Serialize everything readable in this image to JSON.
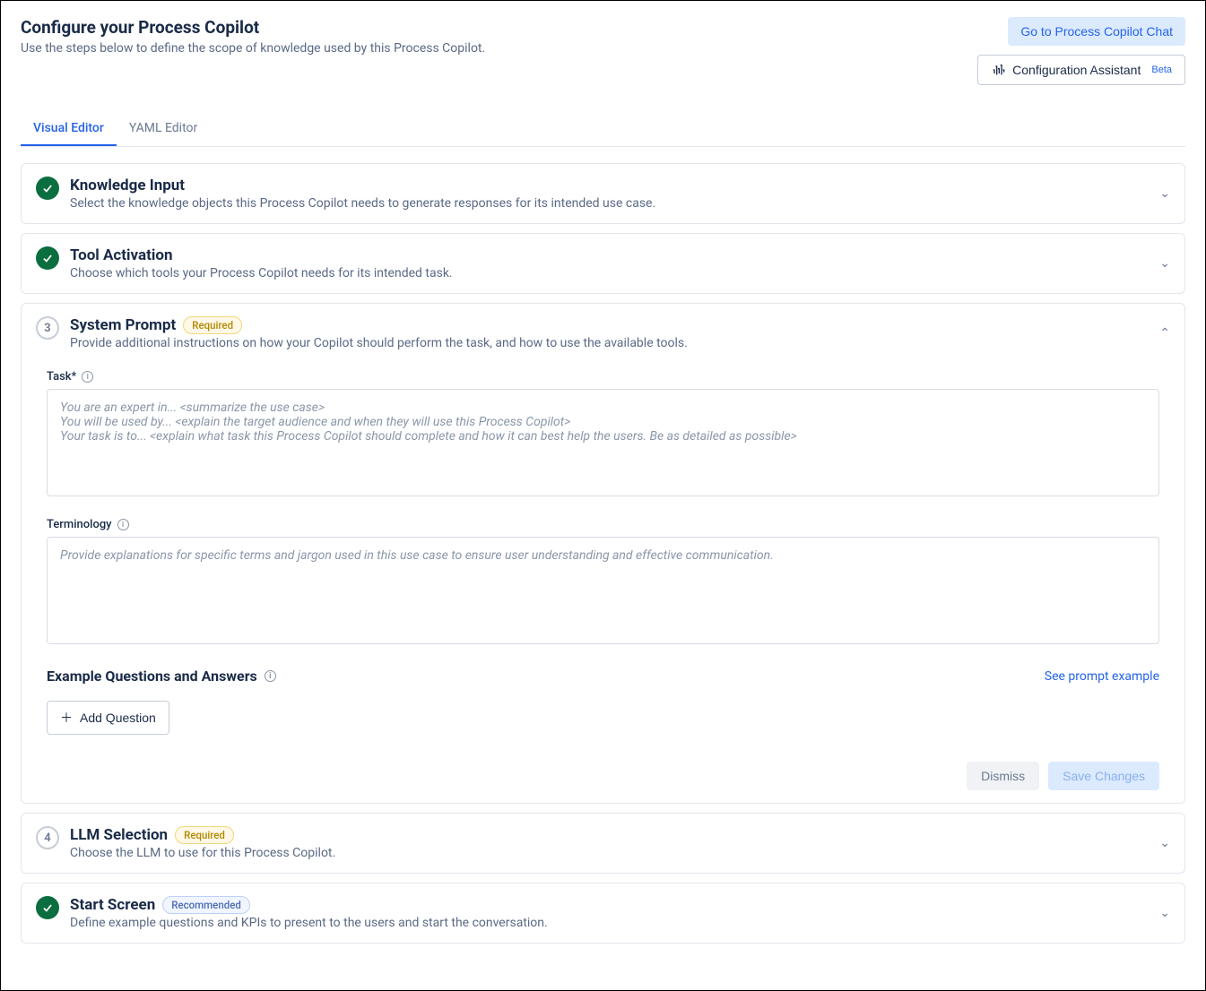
{
  "header": {
    "title": "Configure your Process Copilot",
    "subtitle": "Use the steps below to define the scope of knowledge used by this Process Copilot.",
    "go_chat": "Go to Process Copilot Chat",
    "config_assistant": "Configuration Assistant",
    "beta": "Beta"
  },
  "tabs": {
    "visual": "Visual Editor",
    "yaml": "YAML Editor"
  },
  "sections": {
    "knowledge": {
      "title": "Knowledge Input",
      "sub": "Select the knowledge objects this Process Copilot needs to generate responses for its intended use case."
    },
    "tool": {
      "title": "Tool Activation",
      "sub": "Choose which tools your Process Copilot needs for its intended task."
    },
    "system": {
      "num": "3",
      "title": "System Prompt",
      "pill": "Required",
      "sub": "Provide additional instructions on how your Copilot should perform the task, and how to use the available tools.",
      "task_label": "Task*",
      "task_placeholder": "You are an expert in... <summarize the use case>\nYou will be used by... <explain the target audience and when they will use this Process Copilot>\nYour task is to... <explain what task this Process Copilot should complete and how it can best help the users. Be as detailed as possible>",
      "term_label": "Terminology",
      "term_placeholder": "Provide explanations for specific terms and jargon used in this use case to ensure user understanding and effective communication.",
      "example_title": "Example Questions and Answers",
      "see_example": "See prompt example",
      "add_q": "Add Question",
      "dismiss": "Dismiss",
      "save": "Save Changes"
    },
    "llm": {
      "num": "4",
      "title": "LLM Selection",
      "pill": "Required",
      "sub": "Choose the LLM to use for this Process Copilot."
    },
    "start": {
      "title": "Start Screen",
      "pill": "Recommended",
      "sub": "Define example questions and KPIs to present to the users and start the conversation."
    }
  }
}
